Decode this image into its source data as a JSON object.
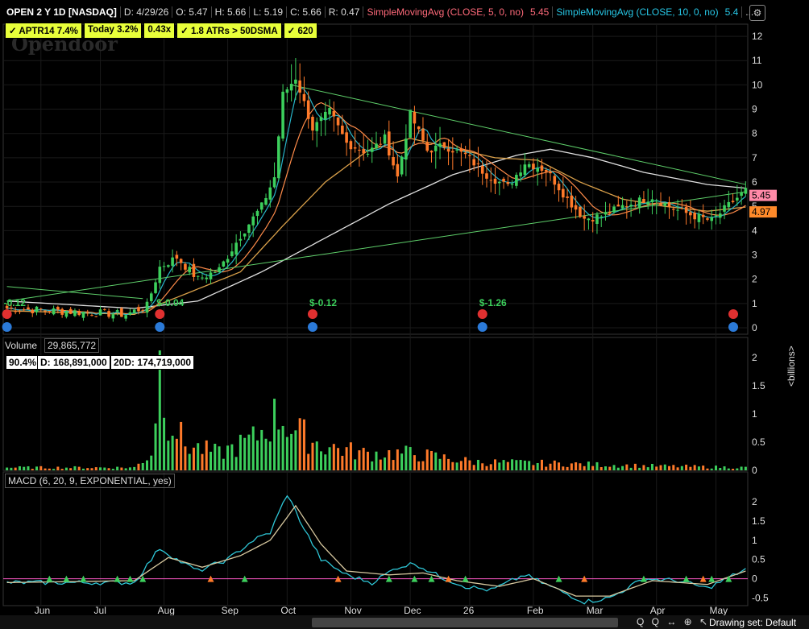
{
  "header": {
    "symbol": "OPEN 2 Y 1D [NASDAQ]",
    "date": "D: 4/29/26",
    "open": "O: 5.47",
    "high": "H: 5.66",
    "low": "L: 5.19",
    "close": "C: 5.66",
    "range": "R: 0.47",
    "sma5_label": "SimpleMovingAvg (CLOSE, 5, 0, no)",
    "sma5_value": "5.45",
    "sma10_label": "SimpleMovingAvg (CLOSE, 10, 0, no)",
    "sma10_value": "5.4",
    "more": "..."
  },
  "badges": [
    "✓ APTR14 7.4%",
    "Today 3.2%",
    "0.43x",
    "✓ 1.8 ATRs > 50DSMA",
    "✓ 620"
  ],
  "watermark": "Opendoor",
  "volume": {
    "label": "Volume",
    "total": "29,865,772",
    "pct": "90.4%",
    "d": "D: 168,891,000",
    "d20": "20D: 174,719,000",
    "unit_label": "<billions>"
  },
  "macd": {
    "label": "MACD (6, 20, 9, EXPONENTIAL, yes)"
  },
  "footer": {
    "drawing_set": "Drawing set: Default",
    "tools": "Q Q ↔ ⊕ ↖"
  },
  "colors": {
    "up": "#3ccf5c",
    "down": "#ff7a2a",
    "sma5": "#27b4c8",
    "sma10": "#ff8c4a",
    "sma50": "#d9a04a",
    "sma200": "#e0e0e0",
    "trend": "#5ecf6a",
    "macd": "#2ec6d6",
    "signal": "#d8c9a0"
  },
  "chart_data": [
    {
      "type": "candlestick",
      "title": "OPEN 2 Y 1D [NASDAQ]",
      "xlabels": [
        "Jun",
        "Jul",
        "Aug",
        "Sep",
        "Oct",
        "Nov",
        "Dec",
        "26",
        "Feb",
        "Mar",
        "Apr",
        "May"
      ],
      "ylim": [
        0,
        12.5
      ],
      "yticks": [
        0,
        1,
        2,
        3,
        4,
        5,
        6,
        7,
        8,
        9,
        10,
        11,
        12
      ],
      "price_tags": [
        "5.45",
        "4.97"
      ],
      "earnings_labels": [
        "-0.12",
        "$-0.04",
        "$-0.12",
        "$-1.26"
      ],
      "close_keypoints": [
        {
          "x": 0,
          "y": 0.8
        },
        {
          "x": 20,
          "y": 0.62
        },
        {
          "x": 28,
          "y": 0.55
        },
        {
          "x": 33,
          "y": 0.9
        },
        {
          "x": 36,
          "y": 2.5
        },
        {
          "x": 40,
          "y": 2.9
        },
        {
          "x": 45,
          "y": 2.0
        },
        {
          "x": 50,
          "y": 2.4
        },
        {
          "x": 55,
          "y": 3.8
        },
        {
          "x": 60,
          "y": 5.0
        },
        {
          "x": 63,
          "y": 6.2
        },
        {
          "x": 65,
          "y": 9.6
        },
        {
          "x": 68,
          "y": 10.3
        },
        {
          "x": 72,
          "y": 8.2
        },
        {
          "x": 76,
          "y": 8.9
        },
        {
          "x": 80,
          "y": 7.6
        },
        {
          "x": 85,
          "y": 7.2
        },
        {
          "x": 89,
          "y": 7.8
        },
        {
          "x": 92,
          "y": 6.2
        },
        {
          "x": 95,
          "y": 8.8
        },
        {
          "x": 99,
          "y": 7.3
        },
        {
          "x": 103,
          "y": 7.5
        },
        {
          "x": 108,
          "y": 7.1
        },
        {
          "x": 113,
          "y": 6.3
        },
        {
          "x": 118,
          "y": 5.8
        },
        {
          "x": 122,
          "y": 6.8
        },
        {
          "x": 127,
          "y": 6.5
        },
        {
          "x": 132,
          "y": 5.3
        },
        {
          "x": 136,
          "y": 4.5
        },
        {
          "x": 140,
          "y": 4.6
        },
        {
          "x": 145,
          "y": 5.0
        },
        {
          "x": 152,
          "y": 5.4
        },
        {
          "x": 157,
          "y": 4.9
        },
        {
          "x": 162,
          "y": 4.6
        },
        {
          "x": 166,
          "y": 4.4
        },
        {
          "x": 171,
          "y": 5.2
        },
        {
          "x": 174,
          "y": 5.66
        }
      ],
      "sma50_keypoints": [
        {
          "x": 0,
          "y": 0.7
        },
        {
          "x": 30,
          "y": 0.55
        },
        {
          "x": 45,
          "y": 1.6
        },
        {
          "x": 55,
          "y": 2.3
        },
        {
          "x": 65,
          "y": 4.2
        },
        {
          "x": 75,
          "y": 6.0
        },
        {
          "x": 85,
          "y": 7.3
        },
        {
          "x": 95,
          "y": 7.8
        },
        {
          "x": 105,
          "y": 7.4
        },
        {
          "x": 115,
          "y": 7.0
        },
        {
          "x": 125,
          "y": 6.9
        },
        {
          "x": 135,
          "y": 6.0
        },
        {
          "x": 145,
          "y": 5.3
        },
        {
          "x": 155,
          "y": 5.0
        },
        {
          "x": 165,
          "y": 4.8
        },
        {
          "x": 174,
          "y": 4.97
        }
      ],
      "sma200_keypoints": [
        {
          "x": 0,
          "y": 1.1
        },
        {
          "x": 30,
          "y": 0.8
        },
        {
          "x": 45,
          "y": 1.1
        },
        {
          "x": 60,
          "y": 2.3
        },
        {
          "x": 75,
          "y": 3.7
        },
        {
          "x": 90,
          "y": 5.1
        },
        {
          "x": 105,
          "y": 6.3
        },
        {
          "x": 120,
          "y": 7.1
        },
        {
          "x": 128,
          "y": 7.35
        },
        {
          "x": 138,
          "y": 7.0
        },
        {
          "x": 150,
          "y": 6.4
        },
        {
          "x": 165,
          "y": 5.9
        },
        {
          "x": 174,
          "y": 5.75
        }
      ],
      "trendlines": [
        {
          "x1": 0,
          "y1": 1.7,
          "x2": 32,
          "y2": 1.2
        },
        {
          "x1": 67,
          "y1": 10.0,
          "x2": 174,
          "y2": 5.9
        },
        {
          "x1": 0,
          "y1": 1.1,
          "x2": 174,
          "y2": 5.6
        }
      ]
    },
    {
      "type": "bar",
      "title": "Volume",
      "ylabel": "<billions>",
      "ylim": [
        0,
        2.1
      ],
      "yticks": [
        0,
        0.5,
        1,
        1.5,
        2
      ],
      "volume_keypoints": [
        {
          "x": 0,
          "y": 0.05
        },
        {
          "x": 30,
          "y": 0.05
        },
        {
          "x": 34,
          "y": 0.3
        },
        {
          "x": 36,
          "y": 1.9
        },
        {
          "x": 38,
          "y": 1.0
        },
        {
          "x": 42,
          "y": 0.45
        },
        {
          "x": 50,
          "y": 0.3
        },
        {
          "x": 58,
          "y": 0.55
        },
        {
          "x": 64,
          "y": 1.0
        },
        {
          "x": 68,
          "y": 0.7
        },
        {
          "x": 74,
          "y": 0.45
        },
        {
          "x": 84,
          "y": 0.3
        },
        {
          "x": 95,
          "y": 0.3
        },
        {
          "x": 110,
          "y": 0.15
        },
        {
          "x": 130,
          "y": 0.12
        },
        {
          "x": 150,
          "y": 0.08
        },
        {
          "x": 174,
          "y": 0.05
        }
      ]
    },
    {
      "type": "line",
      "title": "MACD (6, 20, 9, EXPONENTIAL, yes)",
      "ylim": [
        -0.7,
        2.4
      ],
      "yticks": [
        -0.5,
        0,
        0.5,
        1,
        1.5,
        2
      ],
      "series": [
        {
          "name": "MACD",
          "keypoints": [
            {
              "x": 0,
              "y": -0.1
            },
            {
              "x": 30,
              "y": -0.1
            },
            {
              "x": 36,
              "y": 0.8
            },
            {
              "x": 40,
              "y": 0.5
            },
            {
              "x": 45,
              "y": 0.2
            },
            {
              "x": 52,
              "y": 0.5
            },
            {
              "x": 58,
              "y": 1.0
            },
            {
              "x": 62,
              "y": 1.2
            },
            {
              "x": 66,
              "y": 2.2
            },
            {
              "x": 70,
              "y": 1.3
            },
            {
              "x": 74,
              "y": 0.5
            },
            {
              "x": 80,
              "y": 0.1
            },
            {
              "x": 86,
              "y": -0.1
            },
            {
              "x": 92,
              "y": 0.3
            },
            {
              "x": 96,
              "y": 0.4
            },
            {
              "x": 102,
              "y": 0.05
            },
            {
              "x": 108,
              "y": -0.2
            },
            {
              "x": 114,
              "y": -0.3
            },
            {
              "x": 122,
              "y": 0.1
            },
            {
              "x": 128,
              "y": -0.2
            },
            {
              "x": 136,
              "y": -0.6
            },
            {
              "x": 142,
              "y": -0.5
            },
            {
              "x": 150,
              "y": 0.0
            },
            {
              "x": 158,
              "y": -0.05
            },
            {
              "x": 165,
              "y": -0.25
            },
            {
              "x": 174,
              "y": 0.25
            }
          ]
        },
        {
          "name": "Signal",
          "keypoints": [
            {
              "x": 0,
              "y": -0.1
            },
            {
              "x": 30,
              "y": -0.05
            },
            {
              "x": 38,
              "y": 0.55
            },
            {
              "x": 46,
              "y": 0.3
            },
            {
              "x": 55,
              "y": 0.6
            },
            {
              "x": 62,
              "y": 1.0
            },
            {
              "x": 68,
              "y": 1.9
            },
            {
              "x": 74,
              "y": 0.9
            },
            {
              "x": 80,
              "y": 0.2
            },
            {
              "x": 90,
              "y": 0.1
            },
            {
              "x": 98,
              "y": 0.15
            },
            {
              "x": 106,
              "y": -0.05
            },
            {
              "x": 116,
              "y": -0.2
            },
            {
              "x": 124,
              "y": 0.0
            },
            {
              "x": 134,
              "y": -0.45
            },
            {
              "x": 142,
              "y": -0.45
            },
            {
              "x": 152,
              "y": -0.05
            },
            {
              "x": 165,
              "y": -0.15
            },
            {
              "x": 174,
              "y": 0.2
            }
          ]
        }
      ]
    }
  ]
}
